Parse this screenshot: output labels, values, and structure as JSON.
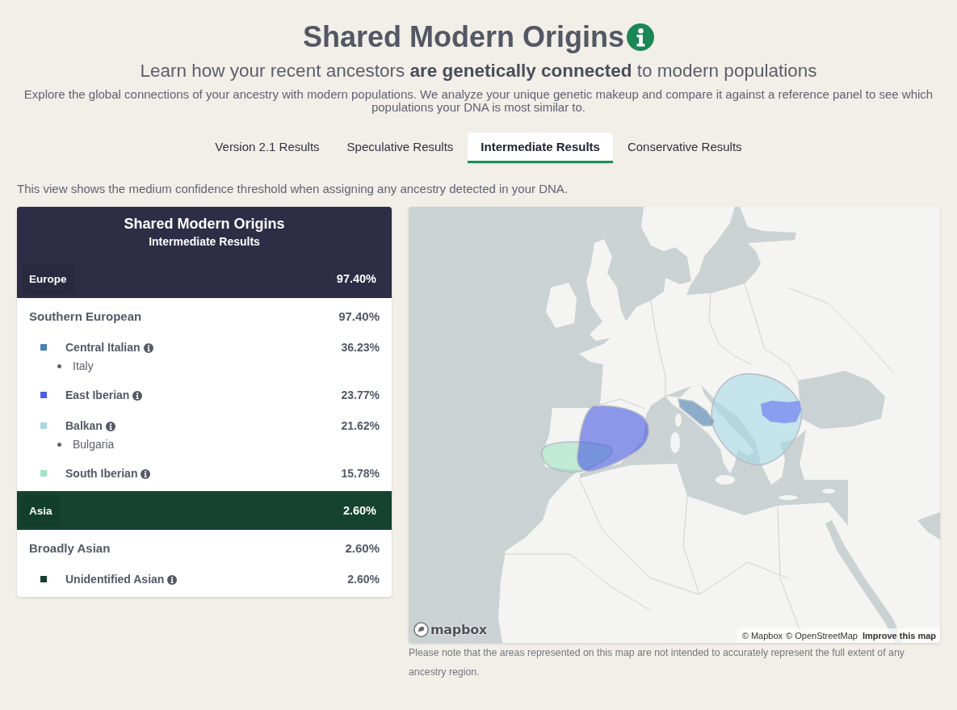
{
  "header": {
    "title": "Shared Modern Origins",
    "subtitle": "Learn how your recent ancestors **are genetically connected** to modern populations",
    "description": "Explore the global connections of your ancestry with modern populations. We analyze your unique genetic makeup and compare it against a reference panel to see which populations your DNA is most similar to."
  },
  "tabs": [
    {
      "label": "Version 2.1 Results",
      "selected": false
    },
    {
      "label": "Speculative Results",
      "selected": false
    },
    {
      "label": "Intermediate Results",
      "selected": true
    },
    {
      "label": "Conservative Results",
      "selected": false
    }
  ],
  "threshold_note": "This view shows the medium confidence threshold when assigning any ancestry detected in your DNA.",
  "results_panel": {
    "title": "Shared Modern Origins",
    "subtitle": "Intermediate Results",
    "regions": [
      {
        "name": "Europe",
        "percent": "97.40%",
        "color": "#2d2e45",
        "groups": [
          {
            "name": "Southern European",
            "percent": "97.40%",
            "populations": [
              {
                "name": "Central Italian",
                "percent": "36.23%",
                "color": "#4a80b3",
                "countries": [
                  "Italy"
                ]
              },
              {
                "name": "East Iberian",
                "percent": "23.77%",
                "color": "#4a5ee3"
              },
              {
                "name": "Balkan",
                "percent": "21.62%",
                "color": "#a8d8e6",
                "countries": [
                  "Bulgaria"
                ]
              },
              {
                "name": "South Iberian",
                "percent": "15.78%",
                "color": "#a0e4c4"
              }
            ]
          }
        ]
      },
      {
        "name": "Asia",
        "percent": "2.60%",
        "color": "#15432f",
        "groups": [
          {
            "name": "Broadly Asian",
            "percent": "2.60%",
            "populations": [
              {
                "name": "Unidentified Asian",
                "percent": "2.60%",
                "color": "#16402f"
              }
            ]
          }
        ]
      }
    ]
  },
  "map": {
    "logo": "mapbox",
    "attribution": [
      "© Mapbox",
      "© OpenStreetMap"
    ],
    "improve_link": "Improve this map",
    "note": "Please note that the areas represented on this map are not intended to accurately represent the full extent of any ancestry region."
  }
}
